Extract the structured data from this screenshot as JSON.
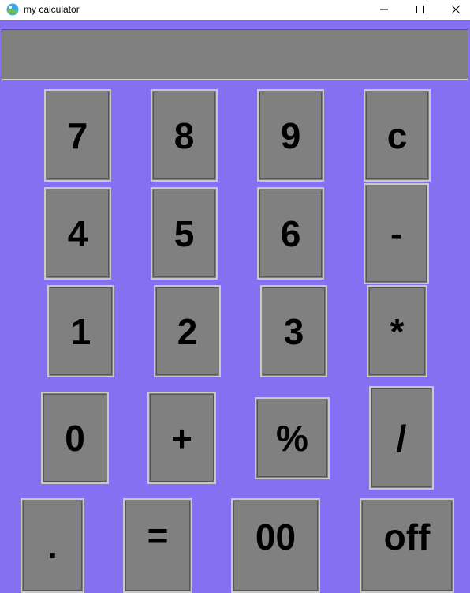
{
  "window": {
    "title": "my calculator",
    "controls": [
      "minimize",
      "maximize",
      "close"
    ]
  },
  "display": {
    "value": ""
  },
  "keys": {
    "k7": "7",
    "k8": "8",
    "k9": "9",
    "kc": "c",
    "k4": "4",
    "k5": "5",
    "k6": "6",
    "kminus": "-",
    "k1": "1",
    "k2": "2",
    "k3": "3",
    "kmul": "*",
    "k0": "0",
    "kplus": "+",
    "kpercent": "%",
    "kdiv": "/",
    "kdot": ".",
    "keq": "=",
    "k00": "00",
    "koff": "off"
  },
  "colors": {
    "background": "#8470f0",
    "key_face": "#808080",
    "display": "#808080"
  }
}
